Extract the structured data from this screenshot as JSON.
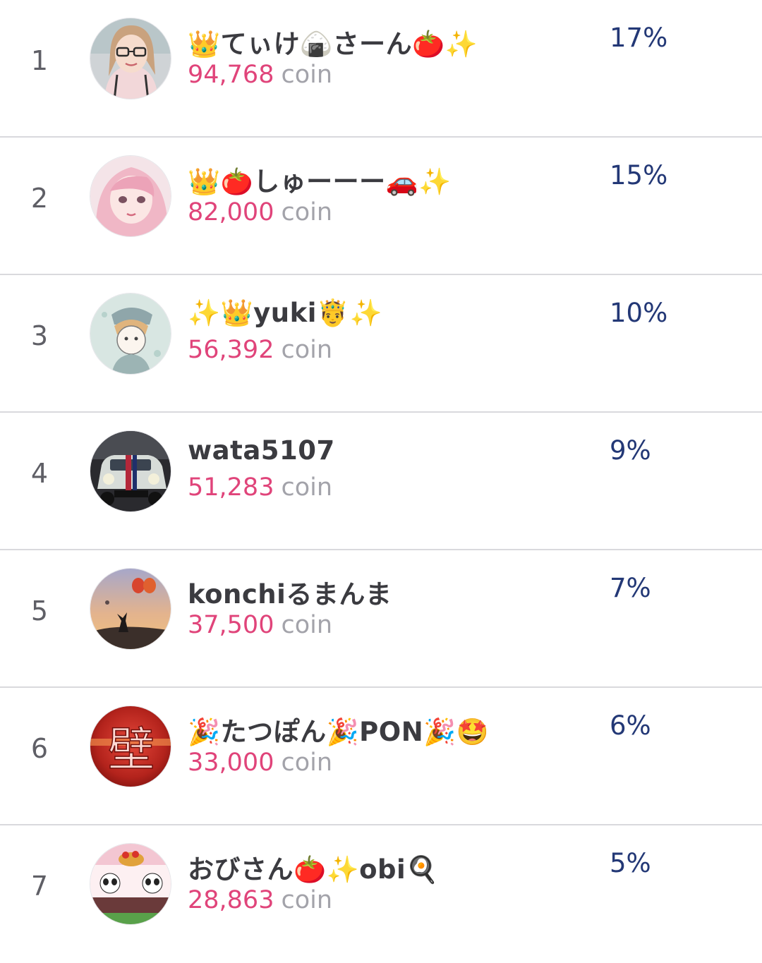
{
  "ranking": [
    {
      "rank": "1",
      "name": "👑てぃけ🍙さーん🍅✨",
      "coins": "94,768",
      "unit": "coin",
      "percent": "17%",
      "avatar": "avatar-woman-glasses"
    },
    {
      "rank": "2",
      "name": "👑🍅しゅーーー🚗✨",
      "coins": "82,000",
      "unit": "coin",
      "percent": "15%",
      "avatar": "avatar-pink-hair"
    },
    {
      "rank": "3",
      "name": "✨👑yuki🤴✨",
      "coins": "56,392",
      "unit": "coin",
      "percent": "10%",
      "avatar": "avatar-illustration"
    },
    {
      "rank": "4",
      "name": "wata5107",
      "coins": "51,283",
      "unit": "coin",
      "percent": "9%",
      "avatar": "avatar-car"
    },
    {
      "rank": "5",
      "name": "konchiるまんま",
      "coins": "37,500",
      "unit": "coin",
      "percent": "7%",
      "avatar": "avatar-balloons-sunset"
    },
    {
      "rank": "6",
      "name": "🎉たつぽん🎉PON🎉🤩",
      "coins": "33,000",
      "unit": "coin",
      "percent": "6%",
      "avatar": "avatar-kanji-wall",
      "avatar_text": "壁"
    },
    {
      "rank": "7",
      "name": "おびさん🍅✨obi🍳",
      "coins": "28,863",
      "unit": "coin",
      "percent": "5%",
      "avatar": "avatar-pandas"
    }
  ],
  "colors": {
    "coin_value": "#e0447a",
    "coin_unit": "#a3a3aa",
    "percent": "#233876",
    "rank": "#5f5f66",
    "name": "#3b3b40",
    "divider": "#d9d9dd"
  }
}
